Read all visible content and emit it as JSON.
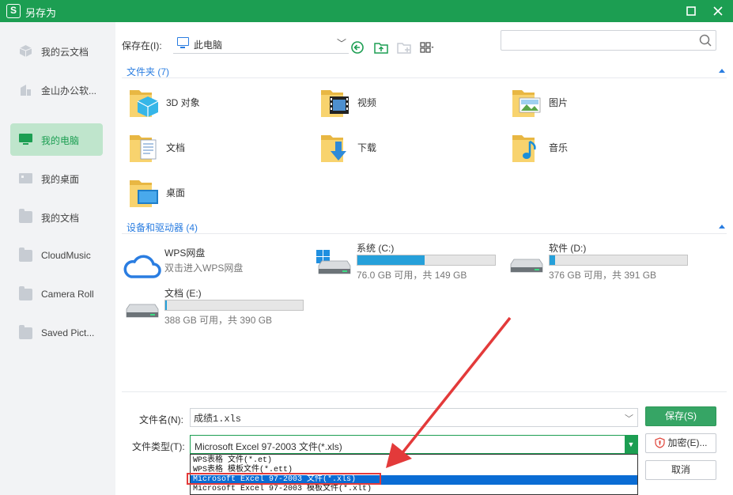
{
  "window": {
    "title": "另存为",
    "logo_glyph": "S"
  },
  "sidebar": {
    "items": [
      {
        "label": "我的云文档",
        "icon": "cloud-cube-icon"
      },
      {
        "label": "金山办公软...",
        "icon": "office-building-icon"
      },
      {
        "label": "我的电脑",
        "icon": "computer-icon",
        "active": true
      },
      {
        "label": "我的桌面",
        "icon": "desktop-icon"
      },
      {
        "label": "我的文档",
        "icon": "folder-icon"
      },
      {
        "label": "CloudMusic",
        "icon": "folder-icon"
      },
      {
        "label": "Camera Roll",
        "icon": "folder-icon"
      },
      {
        "label": "Saved Pict...",
        "icon": "folder-icon"
      }
    ]
  },
  "toolbar": {
    "save_in_label": "保存在(I):",
    "location": "此电脑",
    "search_placeholder": ""
  },
  "folders_section": {
    "header": "文件夹 (7)",
    "items": [
      {
        "name": "3D 对象",
        "icon": "3d-objects-folder-icon"
      },
      {
        "name": "视频",
        "icon": "videos-folder-icon"
      },
      {
        "name": "图片",
        "icon": "pictures-folder-icon"
      },
      {
        "name": "文档",
        "icon": "documents-folder-icon"
      },
      {
        "name": "下载",
        "icon": "downloads-folder-icon"
      },
      {
        "name": "音乐",
        "icon": "music-folder-icon"
      },
      {
        "name": "桌面",
        "icon": "desktop-folder-icon"
      }
    ]
  },
  "devices_section": {
    "header": "设备和驱动器 (4)",
    "wps": {
      "name": "WPS网盘",
      "sub": "双击进入WPS网盘"
    },
    "drives": [
      {
        "name": "系统 (C:)",
        "free": "76.0 GB 可用，共 149 GB",
        "used_fraction": 0.49,
        "icon": "windows-drive-icon"
      },
      {
        "name": "软件 (D:)",
        "free": "376 GB 可用，共 391 GB",
        "used_fraction": 0.04,
        "icon": "hard-drive-icon"
      },
      {
        "name": "文档 (E:)",
        "free": "388 GB 可用，共 390 GB",
        "used_fraction": 0.01,
        "icon": "hard-drive-icon"
      }
    ]
  },
  "form": {
    "filename_label": "文件名(N):",
    "filename_value": "成绩1.xls",
    "filetype_label": "文件类型(T):",
    "filetype_value": "Microsoft Excel 97-2003 文件(*.xls)",
    "filetype_options": [
      "WPS表格 文件(*.et)",
      "WPS表格 模板文件(*.ett)",
      "Microsoft Excel 97-2003 文件(*.xls)",
      "Microsoft Excel 97-2003 模板文件(*.xlt)"
    ]
  },
  "buttons": {
    "save": "保存(S)",
    "encrypt": "加密(E)...",
    "cancel": "取消"
  },
  "colors": {
    "accent": "#1c9e52",
    "link": "#2a7de1",
    "selection": "#0a6cd4",
    "annotation": "#e33a3a"
  }
}
